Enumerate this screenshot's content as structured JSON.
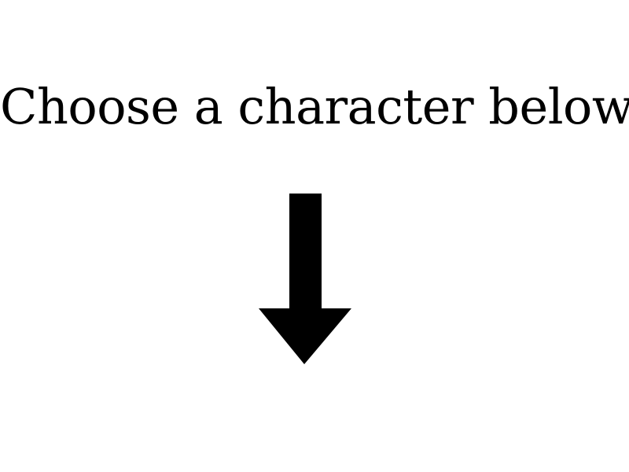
{
  "prompt": {
    "text": "Choose a character below."
  },
  "arrow": {
    "icon": "down-arrow-icon",
    "color": "#000000"
  },
  "background_color": "#ffffff"
}
